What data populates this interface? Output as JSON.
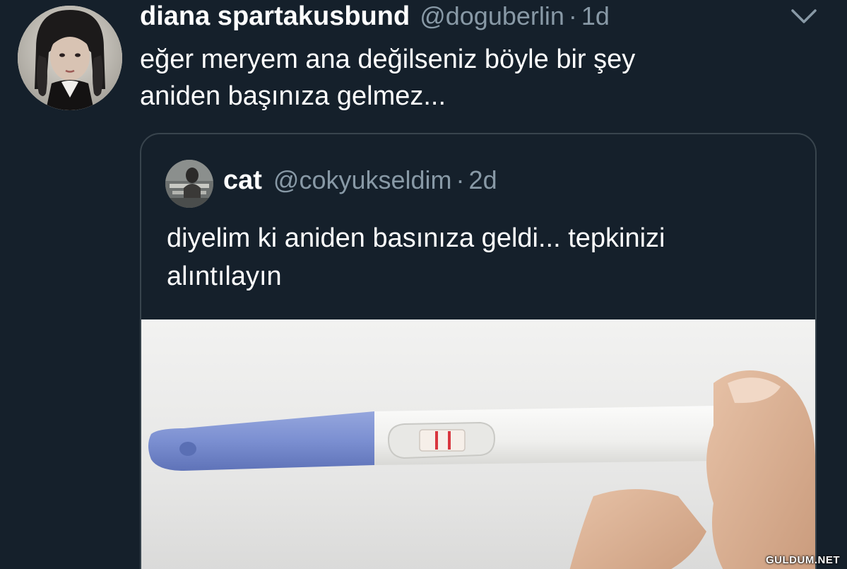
{
  "tweet": {
    "display_name": "diana spartakusbund",
    "handle": "@doguberlin",
    "separator": "·",
    "time": "1d",
    "text_line1": "eğer meryem ana değilseniz böyle bir şey",
    "text_line2": "aniden başınıza gelmez...",
    "menu_icon": "chevron-down-icon"
  },
  "quote": {
    "display_name": "cat",
    "handle": "@cokyukseldim",
    "separator": "·",
    "time": "2d",
    "text_line1": "diyelim ki aniden basınıza geldi... tepkinizi",
    "text_line2": "alıntılayın",
    "media_description": "pregnancy-test-photo"
  },
  "watermark": {
    "text": "GULDUM.NET"
  },
  "colors": {
    "background": "#15202b",
    "secondary_text": "#8899a6",
    "border": "#38444d",
    "test_blue": "#7b8fd1",
    "test_line_red": "#d9363e"
  }
}
